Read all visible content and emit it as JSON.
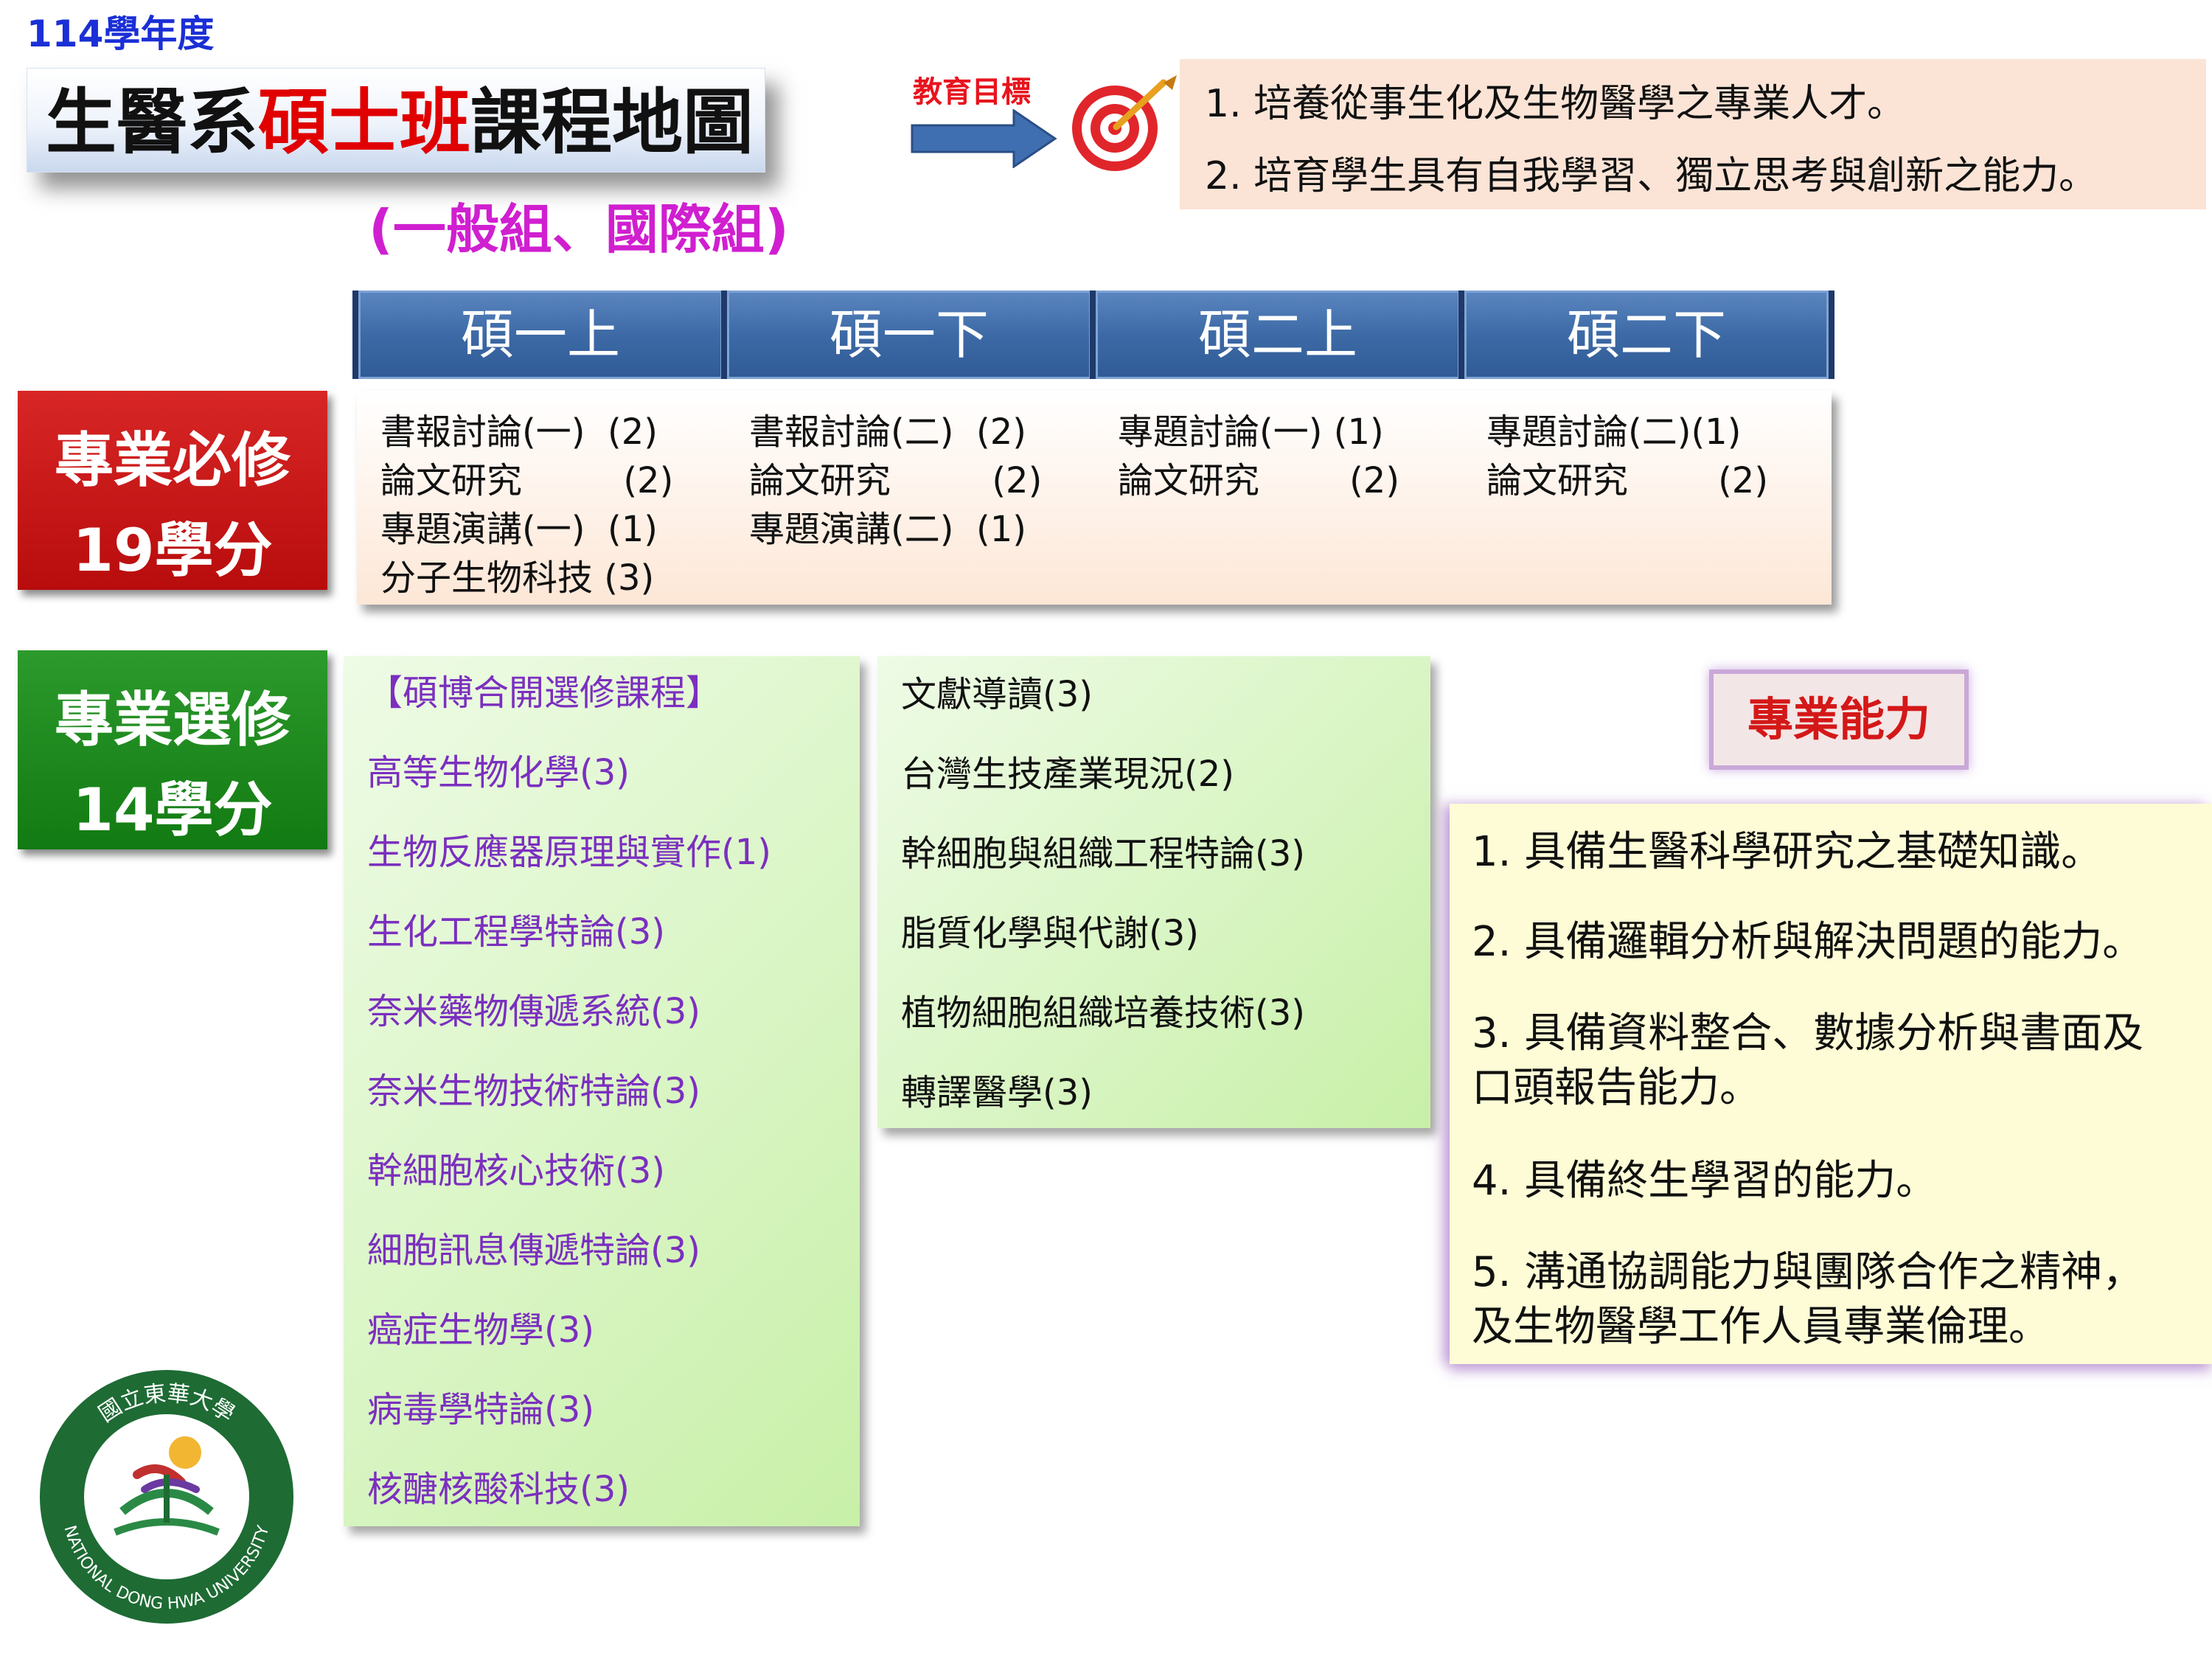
{
  "header": {
    "year": "114學年度",
    "title_pre": "生醫系",
    "title_highlight": "碩士班",
    "title_post": "課程地圖",
    "subtitle": "(一般組、國際組)",
    "goal_label": "教育目標",
    "goals": [
      "1. 培養從事生化及生物醫學之專業人才。",
      "2. 培育學生具有自我學習、獨立思考與創新之能力。"
    ]
  },
  "semesters": [
    "碩一上",
    "碩一下",
    "碩二上",
    "碩二下"
  ],
  "required": {
    "label_line1": "專業必修",
    "label_line2": "19學分",
    "columns": [
      [
        "書報討論(一)  (2)",
        "論文研究         (2)",
        "專題演講(一)  (1)",
        "分子生物科技 (3)"
      ],
      [
        "書報討論(二)  (2)",
        "論文研究         (2)",
        "專題演講(二)  (1)"
      ],
      [
        "專題討論(一) (1)",
        "論文研究        (2)"
      ],
      [
        "專題討論(二)(1)",
        "論文研究        (2)"
      ]
    ]
  },
  "elective": {
    "label_line1": "專業選修",
    "label_line2": "14學分",
    "left": [
      "【碩博合開選修課程】",
      "高等生物化學(3)",
      "生物反應器原理與實作(1)",
      "生化工程學特論(3)",
      "奈米藥物傳遞系統(3)",
      "奈米生物技術特論(3)",
      "幹細胞核心技術(3)",
      "細胞訊息傳遞特論(3)",
      "癌症生物學(3)",
      "病毒學特論(3)",
      "核醣核酸科技(3)"
    ],
    "right": [
      "文獻導讀(3)",
      "台灣生技產業現況(2)",
      "幹細胞與組織工程特論(3)",
      "脂質化學與代謝(3)",
      "植物細胞組織培養技術(3)",
      "轉譯醫學(3)"
    ]
  },
  "abilities": {
    "label": "專業能力",
    "lines": [
      "1. 具備生醫科學研究之基礎知識。",
      "2. 具備邏輯分析與解決問題的能力。",
      "3. 具備資料整合、數據分析與書面及",
      "    口頭報告能力。",
      "4. 具備終生學習的能力。",
      "5. 溝通協調能力與團隊合作之精神，",
      "    及生物醫學工作人員專業倫理。"
    ]
  },
  "logo": {
    "text_cn": "國立東華大學",
    "text_en": "NATIONAL DONG HWA UNIVERSITY"
  },
  "colors": {
    "title_highlight": "#e00000",
    "subtitle": "#d01fd0",
    "semester_header": "#3d6aa6",
    "required_label": "#c81414",
    "elective_label": "#1a8a1a",
    "elective_left_text": "#7b2fbf",
    "ability_label": "#d41818"
  }
}
